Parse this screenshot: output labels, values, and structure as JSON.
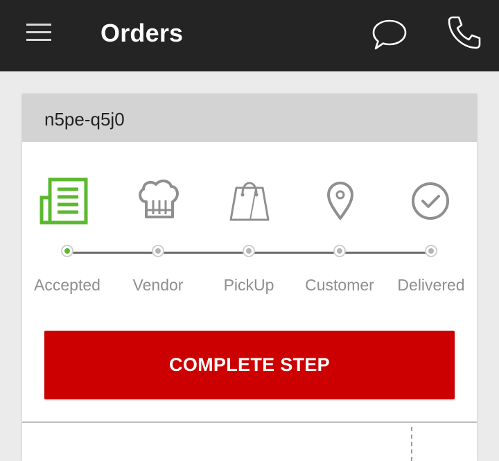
{
  "app_bar": {
    "title": "Orders",
    "menu_icon": "hamburger-menu-icon",
    "chat_icon": "chat-bubble-icon",
    "phone_icon": "phone-icon",
    "background": "#242424"
  },
  "order": {
    "id": "n5pe-q5j0"
  },
  "progress": {
    "accent": "#5cb82f",
    "inactive": "#8f8f8f",
    "current_step": 0,
    "steps": [
      {
        "label": "Accepted",
        "icon": "order-list-icon"
      },
      {
        "label": "Vendor",
        "icon": "chef-hat-icon"
      },
      {
        "label": "PickUp",
        "icon": "shopping-bag-icon"
      },
      {
        "label": "Customer",
        "icon": "location-pin-icon"
      },
      {
        "label": "Delivered",
        "icon": "check-circle-icon"
      }
    ]
  },
  "action": {
    "complete_label": "COMPLETE STEP",
    "color": "#cc0000"
  }
}
